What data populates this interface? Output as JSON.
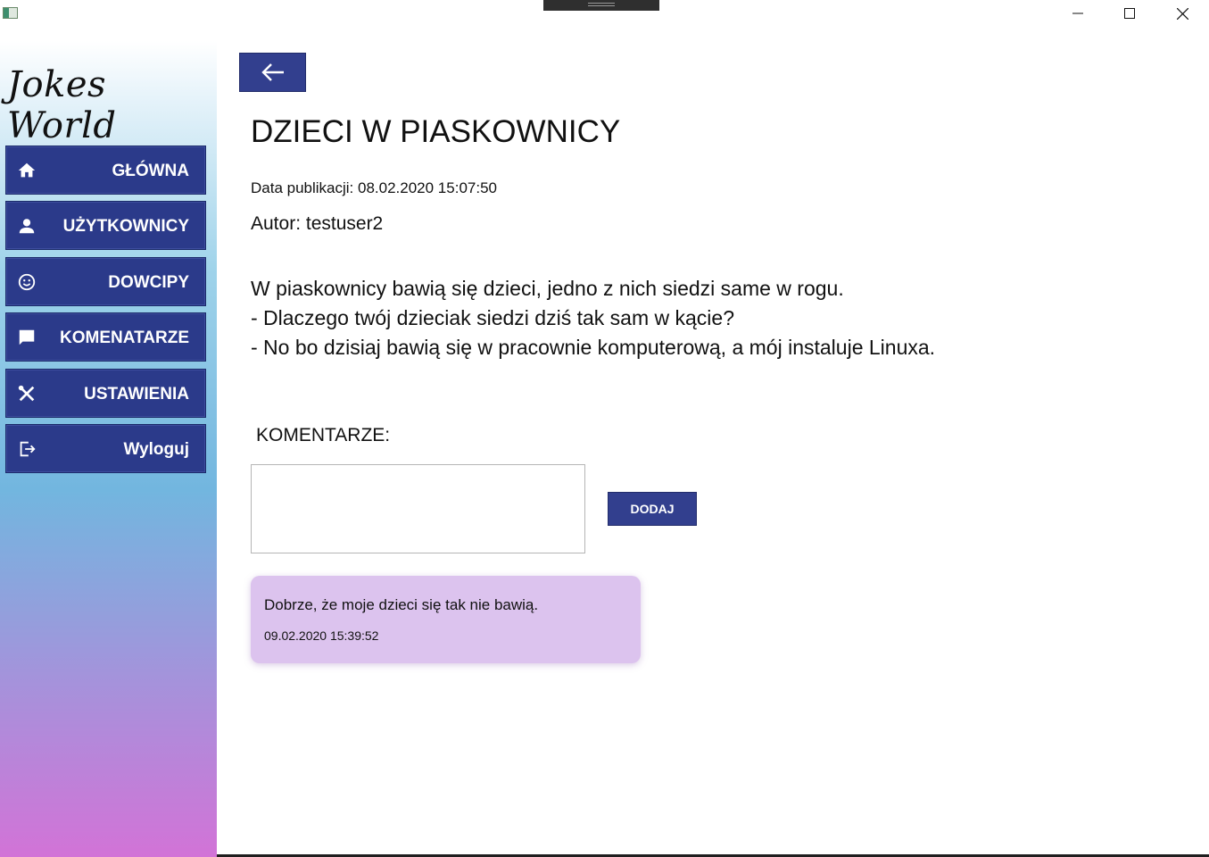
{
  "app": {
    "title": "Jokes World"
  },
  "nav": {
    "items": [
      {
        "label": "GŁÓWNA",
        "icon": "home-icon"
      },
      {
        "label": "UŻYTKOWNICY",
        "icon": "user-icon"
      },
      {
        "label": "DOWCIPY",
        "icon": "smiley-icon"
      },
      {
        "label": "KOMENATARZE",
        "icon": "comment-icon"
      },
      {
        "label": "USTAWIENIA",
        "icon": "tools-icon"
      },
      {
        "label": "Wyloguj",
        "icon": "logout-icon"
      }
    ]
  },
  "joke": {
    "title": "DZIECI W PIASKOWNICY",
    "published": "Data publikacji: 08.02.2020 15:07:50",
    "author": "Autor: testuser2",
    "lines": [
      "W piaskownicy bawią się dzieci, jedno z nich siedzi same w rogu.",
      "- Dlaczego twój dzieciak siedzi dziś tak sam w kącie?",
      "- No bo dzisiaj bawią się w pracownie komputerową, a mój instaluje Linuxa."
    ]
  },
  "comments": {
    "label": "KOMENTARZE:",
    "input_value": "",
    "add_label": "DODAJ",
    "items": [
      {
        "text": "Dobrze, że moje dzieci się tak nie bawią.",
        "date": "09.02.2020 15:39:52"
      }
    ]
  },
  "colors": {
    "button": "#323f8e",
    "nav_button": "#2b3a8a",
    "comment_bg": "#dcc3ee"
  }
}
